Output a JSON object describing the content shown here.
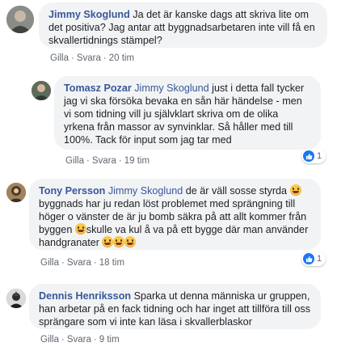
{
  "colors": {
    "link": "#385898",
    "bubble_bg": "#f2f3f5",
    "meta_text": "#606770",
    "like_blue": "#1877f2"
  },
  "comments": [
    {
      "author": "Jimmy Skoglund",
      "text": "Ja det är kanske dags att skriva lite om det positiva? Jag antar att byggnadsarbetaren inte vill få en skvallertidnings stämpel?",
      "like_label": "Gilla",
      "reply_label": "Svara",
      "time": "20 tim"
    },
    {
      "author": "Tomasz Pozar",
      "mention": "Jimmy Skoglund",
      "text": "just i detta fall tycker jag vi ska försöka bevaka en sån här händelse - men vi som tidning vill ju självklart skriva om de olika yrkena från massor av synvinklar. Så håller med till 100%. Tack för input som jag tar med",
      "like_label": "Gilla",
      "reply_label": "Svara",
      "time": "19 tim",
      "reaction_icon": "like-icon",
      "reaction_count": "1"
    },
    {
      "author": "Tony Persson",
      "mention": "Jimmy Skoglund",
      "text_a": "de är väll sosse styrda",
      "text_b": "byggnads har ju redan löst problemet med sprängning till höger o vänster de är ju bomb säkra på att allt kommer från byggen",
      "text_c": "skulle va kul å va på ett bygge där man använder handgranater",
      "emoji_icon": "grinning-face-icon",
      "like_label": "Gilla",
      "reply_label": "Svara",
      "time": "18 tim",
      "reaction_icon": "like-icon",
      "reaction_count": "1"
    },
    {
      "author": "Dennis Henriksson",
      "text": "Sparka ut denna människa ur gruppen, han arbetar på en fack tidning och har inget att tillföra till oss sprängare som vi inte kan läsa i skvallerblaskor",
      "like_label": "Gilla",
      "reply_label": "Svara",
      "time": "9 tim"
    }
  ]
}
